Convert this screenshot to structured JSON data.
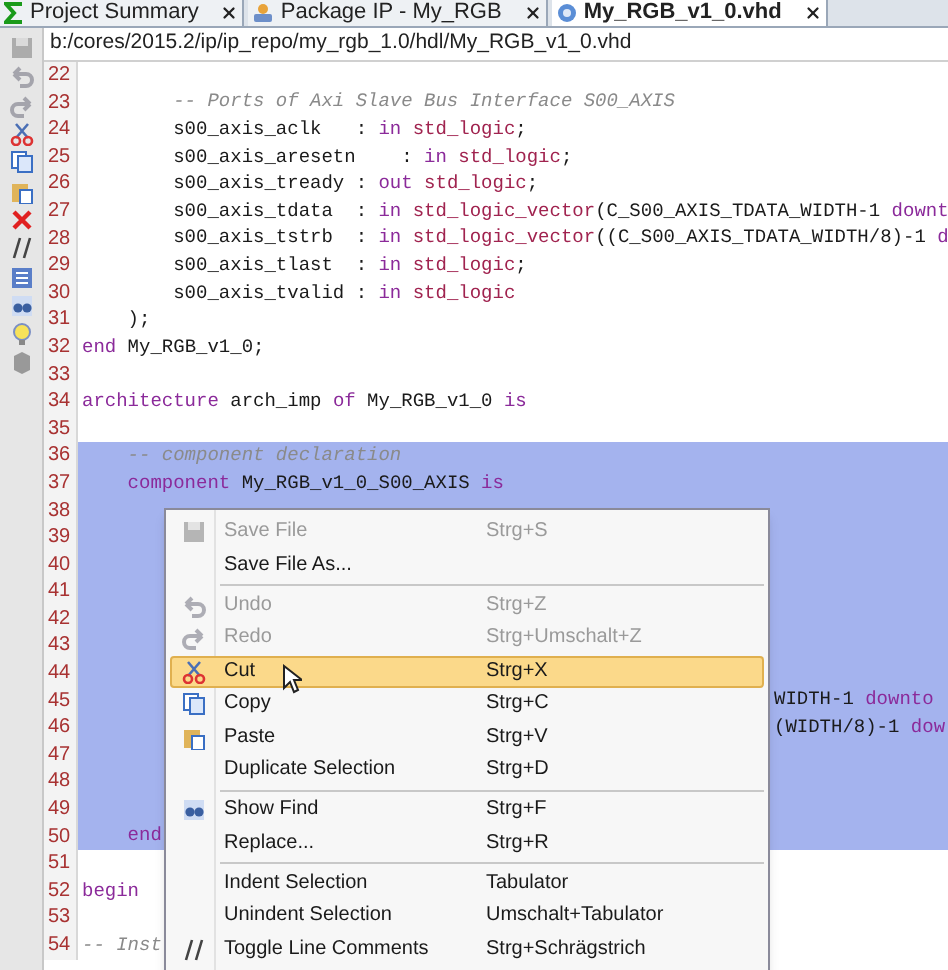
{
  "tabs": [
    {
      "label": "Project Summary",
      "selected": false
    },
    {
      "label": "Package IP - My_RGB",
      "selected": false
    },
    {
      "label": "My_RGB_v1_0.vhd",
      "selected": true
    }
  ],
  "path": "b:/cores/2015.2/ip/ip_repo/my_rgb_1.0/hdl/My_RGB_v1_0.vhd",
  "lines": [
    {
      "number": "22",
      "selected": false
    },
    {
      "number": "23",
      "selected": false,
      "segments": [
        {
          "kind": "comment",
          "text": "        -- Ports of Axi Slave Bus Interface S00_AXIS"
        }
      ]
    },
    {
      "number": "24",
      "selected": false,
      "segments": [
        {
          "kind": "plain",
          "text": "        s00_axis_aclk   : "
        },
        {
          "kind": "keyword",
          "text": "in "
        },
        {
          "kind": "type",
          "text": "std_logic"
        },
        {
          "kind": "plain",
          "text": ";"
        }
      ]
    },
    {
      "number": "25",
      "selected": false,
      "segments": [
        {
          "kind": "plain",
          "text": "        s00_axis_aresetn    : "
        },
        {
          "kind": "keyword",
          "text": "in "
        },
        {
          "kind": "type",
          "text": "std_logic"
        },
        {
          "kind": "plain",
          "text": ";"
        }
      ]
    },
    {
      "number": "26",
      "selected": false,
      "segments": [
        {
          "kind": "plain",
          "text": "        s00_axis_tready : "
        },
        {
          "kind": "keyword",
          "text": "out "
        },
        {
          "kind": "type",
          "text": "std_logic"
        },
        {
          "kind": "plain",
          "text": ";"
        }
      ]
    },
    {
      "number": "27",
      "selected": false,
      "segments": [
        {
          "kind": "plain",
          "text": "        s00_axis_tdata  : "
        },
        {
          "kind": "keyword",
          "text": "in "
        },
        {
          "kind": "type",
          "text": "std_logic_vector"
        },
        {
          "kind": "plain",
          "text": "(C_S00_AXIS_TDATA_WIDTH-1 "
        },
        {
          "kind": "keyword",
          "text": "downt"
        }
      ]
    },
    {
      "number": "28",
      "selected": false,
      "segments": [
        {
          "kind": "plain",
          "text": "        s00_axis_tstrb  : "
        },
        {
          "kind": "keyword",
          "text": "in "
        },
        {
          "kind": "type",
          "text": "std_logic_vector"
        },
        {
          "kind": "plain",
          "text": "((C_S00_AXIS_TDATA_WIDTH/8)-1 "
        },
        {
          "kind": "keyword",
          "text": "d"
        }
      ]
    },
    {
      "number": "29",
      "selected": false,
      "segments": [
        {
          "kind": "plain",
          "text": "        s00_axis_tlast  : "
        },
        {
          "kind": "keyword",
          "text": "in "
        },
        {
          "kind": "type",
          "text": "std_logic"
        },
        {
          "kind": "plain",
          "text": ";"
        }
      ]
    },
    {
      "number": "30",
      "selected": false,
      "segments": [
        {
          "kind": "plain",
          "text": "        s00_axis_tvalid : "
        },
        {
          "kind": "keyword",
          "text": "in "
        },
        {
          "kind": "type",
          "text": "std_logic"
        }
      ]
    },
    {
      "number": "31",
      "selected": false,
      "segments": [
        {
          "kind": "plain",
          "text": "    );"
        }
      ]
    },
    {
      "number": "32",
      "selected": false,
      "segments": [
        {
          "kind": "keyword",
          "text": "end"
        },
        {
          "kind": "plain",
          "text": " My_RGB_v1_0;"
        }
      ]
    },
    {
      "number": "33",
      "selected": false
    },
    {
      "number": "34",
      "selected": false,
      "segments": [
        {
          "kind": "keyword",
          "text": "architecture"
        },
        {
          "kind": "plain",
          "text": " arch_imp "
        },
        {
          "kind": "keyword",
          "text": "of"
        },
        {
          "kind": "plain",
          "text": " My_RGB_v1_0 "
        },
        {
          "kind": "keyword",
          "text": "is"
        }
      ]
    },
    {
      "number": "35",
      "selected": false
    },
    {
      "number": "36",
      "selected": true,
      "segments": [
        {
          "kind": "comment",
          "text": "    -- component declaration"
        }
      ]
    },
    {
      "number": "37",
      "selected": true,
      "segments": [
        {
          "kind": "keyword",
          "text": "    component"
        },
        {
          "kind": "plain",
          "text": " My_RGB_v1_0_S00_AXIS "
        },
        {
          "kind": "keyword",
          "text": "is"
        }
      ]
    },
    {
      "number": "38",
      "selected": true
    },
    {
      "number": "39",
      "selected": true
    },
    {
      "number": "40",
      "selected": true
    },
    {
      "number": "41",
      "selected": true
    },
    {
      "number": "42",
      "selected": true
    },
    {
      "number": "43",
      "selected": true
    },
    {
      "number": "44",
      "selected": true
    },
    {
      "number": "45",
      "selected": true,
      "after_menu": true,
      "segments": [
        {
          "kind": "plain",
          "text": "WIDTH-1 "
        },
        {
          "kind": "keyword",
          "text": "downto"
        }
      ]
    },
    {
      "number": "46",
      "selected": true,
      "after_menu": true,
      "segments": [
        {
          "kind": "plain",
          "text": "(WIDTH/8)-1 "
        },
        {
          "kind": "keyword",
          "text": "dow"
        }
      ]
    },
    {
      "number": "47",
      "selected": true
    },
    {
      "number": "48",
      "selected": true
    },
    {
      "number": "49",
      "selected": true
    },
    {
      "number": "50",
      "selected": true,
      "segments": [
        {
          "kind": "keyword",
          "text": "    end"
        }
      ]
    },
    {
      "number": "51",
      "selected": false
    },
    {
      "number": "52",
      "selected": false,
      "segments": [
        {
          "kind": "keyword",
          "text": "begin"
        }
      ]
    },
    {
      "number": "53",
      "selected": false
    },
    {
      "number": "54",
      "selected": false,
      "segments": [
        {
          "kind": "comment",
          "text": "-- Inst"
        }
      ]
    }
  ],
  "menu": [
    {
      "kind": "item",
      "label": "Save File",
      "shortcut": "Strg+S",
      "disabled": true,
      "selected": false
    },
    {
      "kind": "item",
      "label": "Save File As...",
      "disabled": false,
      "selected": false
    },
    {
      "kind": "separator"
    },
    {
      "kind": "item",
      "label": "Undo",
      "shortcut": "Strg+Z",
      "disabled": true,
      "selected": false
    },
    {
      "kind": "item",
      "label": "Redo",
      "shortcut": "Strg+Umschalt+Z",
      "disabled": true,
      "selected": false
    },
    {
      "kind": "item",
      "label": "Cut",
      "shortcut": "Strg+X",
      "disabled": false,
      "selected": true
    },
    {
      "kind": "item",
      "label": "Copy",
      "shortcut": "Strg+C",
      "disabled": false,
      "selected": false
    },
    {
      "kind": "item",
      "label": "Paste",
      "shortcut": "Strg+V",
      "disabled": false,
      "selected": false
    },
    {
      "kind": "item",
      "label": "Duplicate Selection",
      "shortcut": "Strg+D",
      "disabled": false,
      "selected": false
    },
    {
      "kind": "separator"
    },
    {
      "kind": "item",
      "label": "Show Find",
      "shortcut": "Strg+F",
      "disabled": false,
      "selected": false
    },
    {
      "kind": "item",
      "label": "Replace...",
      "shortcut": "Strg+R",
      "disabled": false,
      "selected": false
    },
    {
      "kind": "separator"
    },
    {
      "kind": "item",
      "label": "Indent Selection",
      "shortcut": "Tabulator",
      "disabled": false,
      "selected": false
    },
    {
      "kind": "item",
      "label": "Unindent Selection",
      "shortcut": "Umschalt+Tabulator",
      "disabled": false,
      "selected": false
    },
    {
      "kind": "item",
      "label": "Toggle Line Comments",
      "shortcut": "Strg+Schrägstrich",
      "disabled": false,
      "selected": false
    }
  ]
}
